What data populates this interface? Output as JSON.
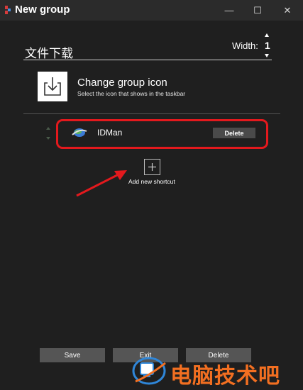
{
  "window": {
    "title": "New group",
    "controls": {
      "minimize": "—",
      "maximize": "☐",
      "close": "✕"
    }
  },
  "group": {
    "name": "文件下载",
    "width_label": "Width:",
    "width_value": "1"
  },
  "group_icon": {
    "title": "Change group icon",
    "subtitle": "Select the icon that shows in the taskbar"
  },
  "shortcuts": [
    {
      "name": "IDMan",
      "delete_label": "Delete",
      "icon": "idm-globe-icon"
    }
  ],
  "add_shortcut": {
    "label": "Add new shortcut"
  },
  "buttons": {
    "save": "Save",
    "exit": "Exit",
    "delete": "Delete"
  },
  "watermark": {
    "text": "电脑技术吧"
  },
  "colors": {
    "background": "#1f1f1f",
    "titlebar": "#2b2b2b",
    "highlight": "#e3191d",
    "button": "#555555",
    "watermark": "#f26f21"
  }
}
